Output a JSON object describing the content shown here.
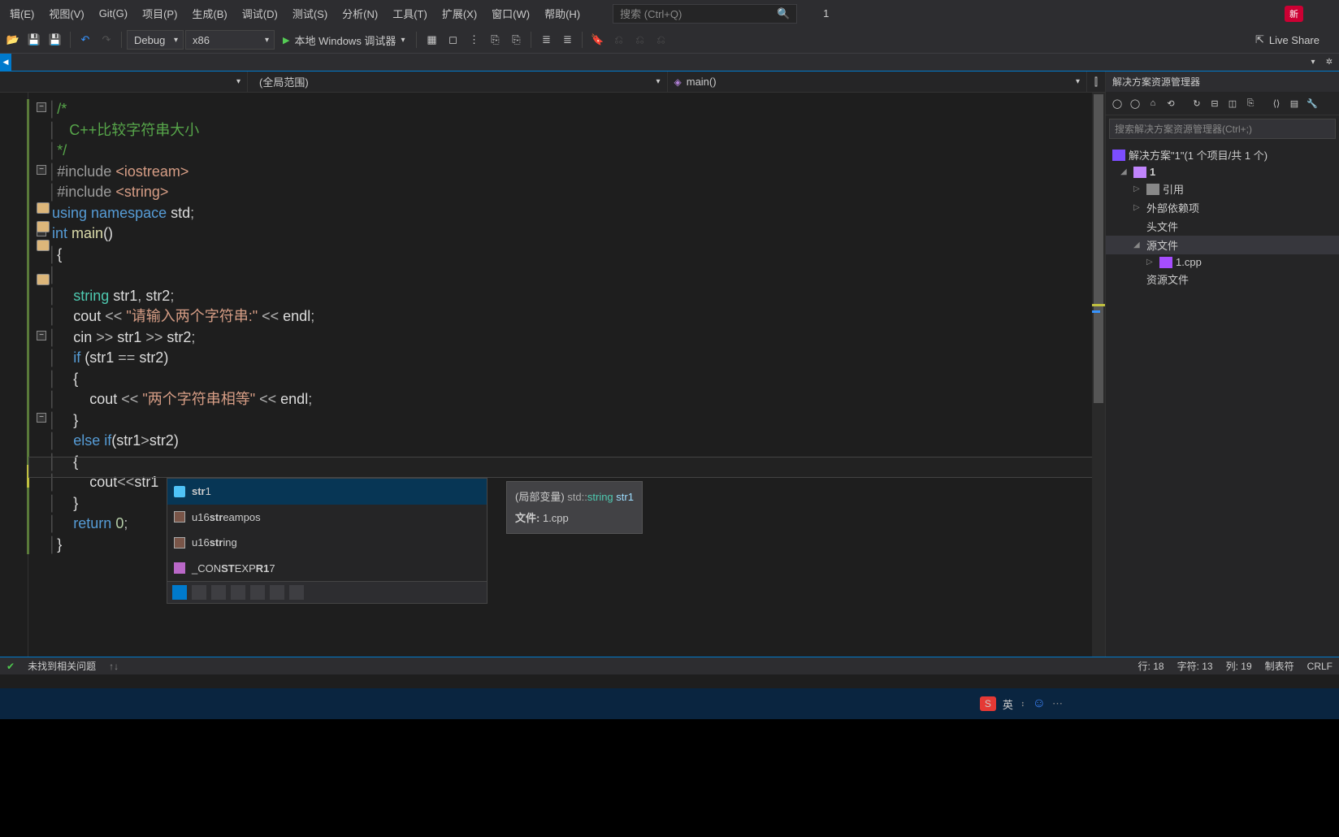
{
  "menu": {
    "items": [
      "辑(E)",
      "视图(V)",
      "Git(G)",
      "项目(P)",
      "生成(B)",
      "调试(D)",
      "测试(S)",
      "分析(N)",
      "工具(T)",
      "扩展(X)",
      "窗口(W)",
      "帮助(H)"
    ],
    "search_placeholder": "搜索 (Ctrl+Q)",
    "project_label": "1",
    "new_badge": "新"
  },
  "toolbar": {
    "config": "Debug",
    "platform": "x86",
    "run_label": "本地 Windows 调试器",
    "live_share": "Live Share"
  },
  "nav": {
    "scope": "(全局范围)",
    "func": "main()"
  },
  "code": {
    "lines": [
      {
        "t": "comment",
        "text": "/*"
      },
      {
        "t": "comment",
        "text": "   C++比较字符串大小"
      },
      {
        "t": "comment",
        "text": "*/"
      },
      {
        "t": "include",
        "text": "#include <iostream>"
      },
      {
        "t": "include",
        "text": "#include <string>"
      },
      {
        "t": "using",
        "text": "using namespace std;"
      },
      {
        "t": "main",
        "text": "int main()"
      },
      {
        "t": "brace",
        "text": "{"
      },
      {
        "t": "blank",
        "text": ""
      },
      {
        "t": "decl",
        "text": "    string str1, str2;"
      },
      {
        "t": "cout1",
        "text": "    cout << \"请输入两个字符串:\" << endl;"
      },
      {
        "t": "cin",
        "text": "    cin >> str1 >> str2;"
      },
      {
        "t": "if",
        "text": "    if (str1 == str2)"
      },
      {
        "t": "brace",
        "text": "    {"
      },
      {
        "t": "cout2",
        "text": "        cout << \"两个字符串相等\" << endl;"
      },
      {
        "t": "brace",
        "text": "    }"
      },
      {
        "t": "elseif",
        "text": "    else if(str1>str2)"
      },
      {
        "t": "brace",
        "text": "    {"
      },
      {
        "t": "cout3",
        "text": "        cout<<str1"
      },
      {
        "t": "brace",
        "text": "    }"
      },
      {
        "t": "return",
        "text": "    return 0;"
      },
      {
        "t": "brace",
        "text": "}"
      }
    ]
  },
  "intellisense": {
    "items": [
      {
        "label": "str1",
        "kind": "var",
        "bold": "str"
      },
      {
        "label": "u16streampos",
        "kind": "type",
        "bold": "str"
      },
      {
        "label": "u16string",
        "kind": "type",
        "bold": "str"
      },
      {
        "label": "_CONSTEXPR17",
        "kind": "def",
        "bold": "ST",
        "bold2": "R1"
      }
    ],
    "tooltip_kind": "(局部变量)",
    "tooltip_ns": "std::",
    "tooltip_type": "string",
    "tooltip_var": "str1",
    "tooltip_file_label": "文件:",
    "tooltip_file": "1.cpp"
  },
  "solution": {
    "title": "解决方案资源管理器",
    "search_placeholder": "搜索解决方案资源管理器(Ctrl+;)",
    "root": "解决方案\"1\"(1 个项目/共 1 个)",
    "project": "1",
    "nodes": [
      "引用",
      "外部依赖项",
      "头文件",
      "源文件",
      "1.cpp",
      "资源文件"
    ]
  },
  "status": {
    "issues": "未找到相关问题",
    "line": "行: 18",
    "char": "字符: 13",
    "col": "列: 19",
    "tab": "制表符",
    "eol": "CRLF"
  },
  "taskbar": {
    "ime_badge": "S",
    "ime_lang": "英"
  }
}
